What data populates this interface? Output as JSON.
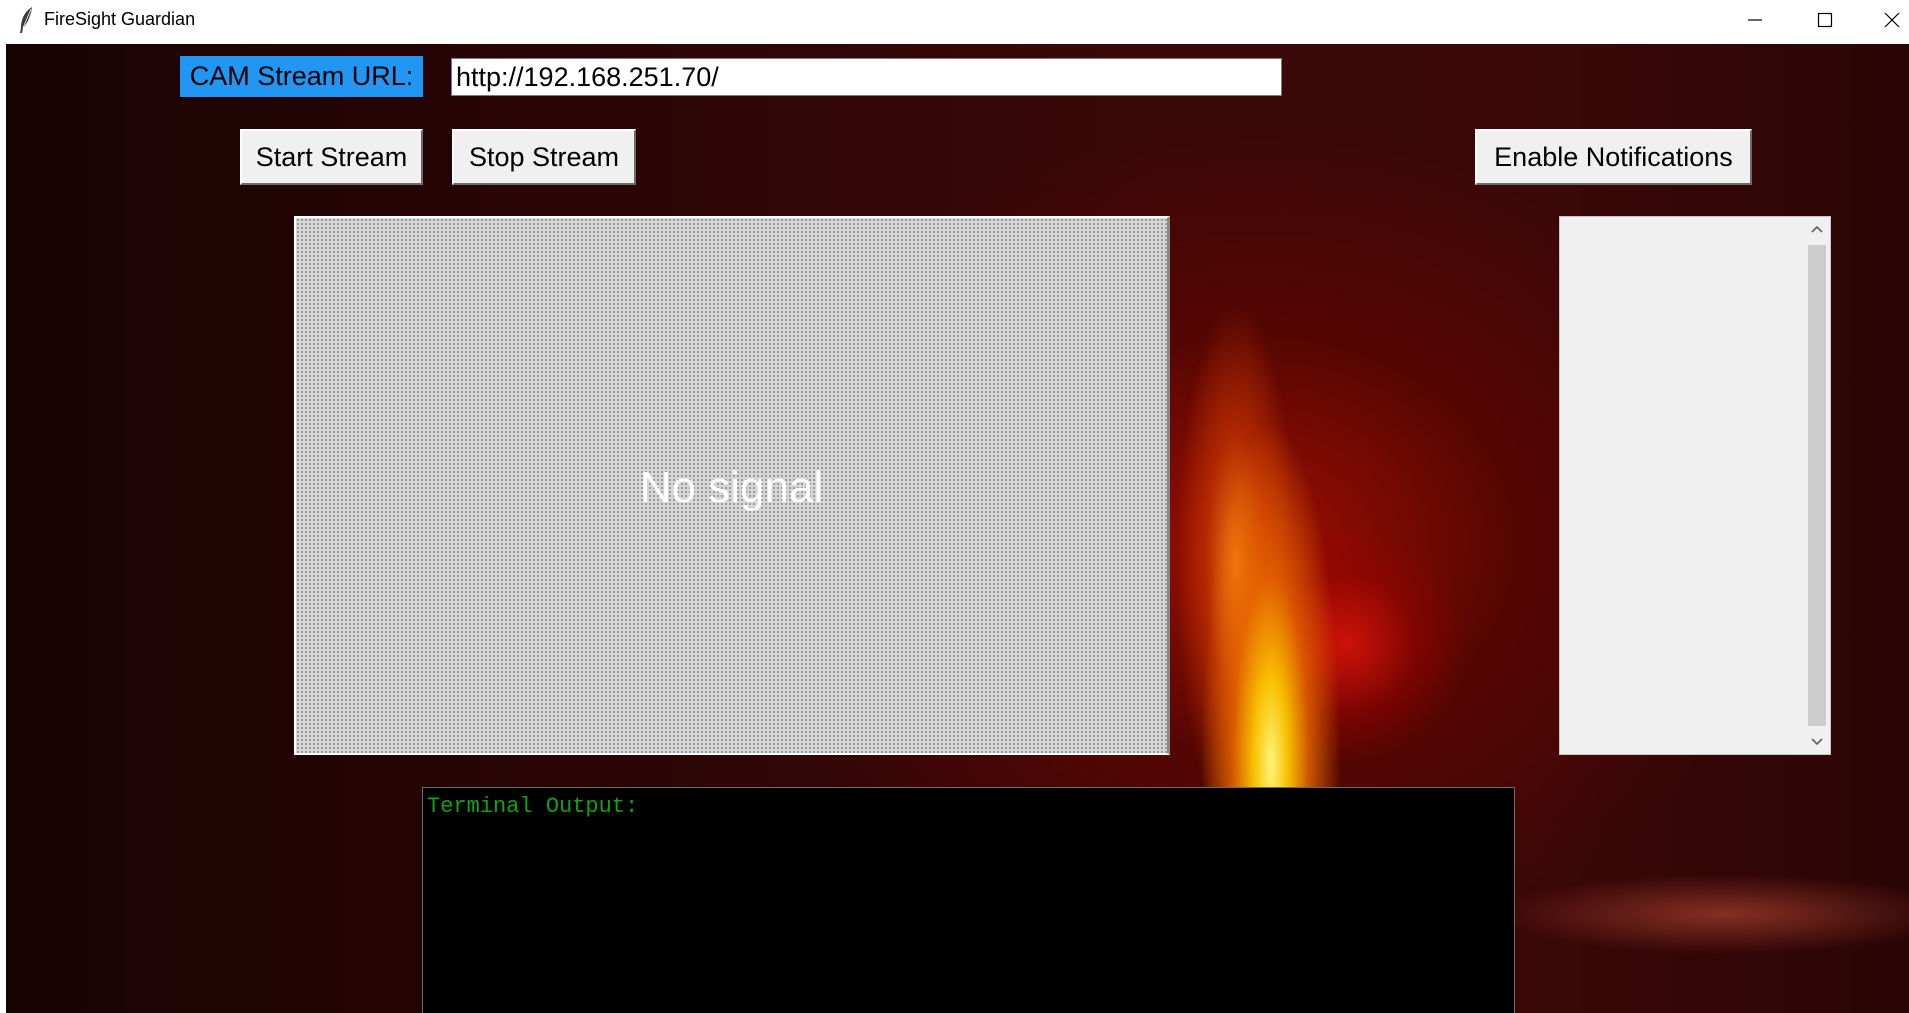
{
  "window": {
    "title": "FireSight Guardian",
    "controls": {
      "minimize_icon": "minimize-icon",
      "maximize_icon": "maximize-icon",
      "close_icon": "close-icon"
    }
  },
  "stream": {
    "url_label": "CAM Stream URL:",
    "url_value": "http://192.168.251.70/",
    "start_label": "Start Stream",
    "stop_label": "Stop Stream"
  },
  "notifications": {
    "enable_label": "Enable Notifications",
    "items": []
  },
  "video": {
    "status_text": "No signal"
  },
  "terminal": {
    "header": "Terminal Output:"
  },
  "colors": {
    "label_bg": "#2196f3",
    "terminal_text": "#13a10e",
    "terminal_bg": "#000000",
    "button_bg": "#f0f0f0"
  }
}
